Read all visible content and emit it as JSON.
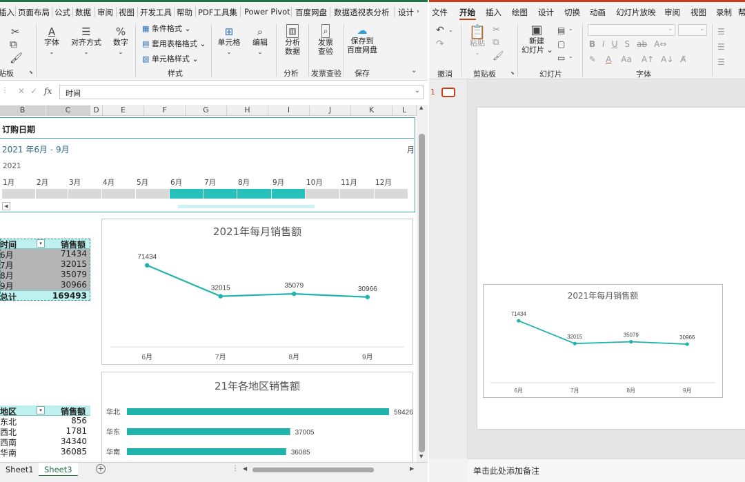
{
  "excel": {
    "tabs": [
      "插入",
      "页面布局",
      "公式",
      "数据",
      "审阅",
      "视图",
      "开发工具",
      "帮助",
      "PDF工具集",
      "Power Pivot",
      "百度网盘",
      "数据透视表分析",
      "设计"
    ],
    "ribbon": {
      "clipboard_group": "贴板",
      "font_label": "字体",
      "align_label": "对齐方式",
      "number_label": "数字",
      "cond_format": "条件格式",
      "table_format": "套用表格格式",
      "cell_style": "单元格样式",
      "style_group": "样式",
      "cells_label": "单元格",
      "edit_label": "编辑",
      "analyze_l1": "分析",
      "analyze_l2": "数据",
      "analyze_group": "分析",
      "invoice_l1": "发票",
      "invoice_l2": "查验",
      "invoice_group": "发票查验",
      "save_l1": "保存到",
      "save_l2": "百度网盘",
      "save_group": "保存"
    },
    "formula_bar": {
      "fx": "fx",
      "value": "时间"
    },
    "columns": [
      "B",
      "C",
      "D",
      "E",
      "F",
      "G",
      "H",
      "I",
      "J",
      "K",
      "L"
    ],
    "slicer": {
      "title": "订购日期",
      "range": "2021 年6月 - 9月",
      "unit": "月",
      "year": "2021",
      "months": [
        "1月",
        "2月",
        "3月",
        "4月",
        "5月",
        "6月",
        "7月",
        "8月",
        "9月",
        "10月",
        "11月",
        "12月"
      ],
      "selected": [
        5,
        6,
        7,
        8
      ]
    },
    "pivot_sales": {
      "header": [
        "时间",
        "销售额"
      ],
      "rows": [
        [
          "6月",
          "71434"
        ],
        [
          "7月",
          "32015"
        ],
        [
          "8月",
          "35079"
        ],
        [
          "9月",
          "30966"
        ]
      ],
      "total": [
        "总计",
        "169493"
      ]
    },
    "pivot_region": {
      "header": [
        "地区",
        "销售额"
      ],
      "rows": [
        [
          "东北",
          "856"
        ],
        [
          "西北",
          "1781"
        ],
        [
          "西南",
          "34340"
        ],
        [
          "华南",
          "36085"
        ]
      ]
    },
    "sheet_tabs": [
      "Sheet1",
      "Sheet3"
    ]
  },
  "ppt": {
    "tabs": [
      "文件",
      "开始",
      "插入",
      "绘图",
      "设计",
      "切换",
      "动画",
      "幻灯片放映",
      "审阅",
      "视图",
      "录制",
      "帮"
    ],
    "ribbon": {
      "undo_group": "撤消",
      "paste": "粘贴",
      "clipboard_group": "剪贴板",
      "new_slide_l1": "新建",
      "new_slide_l2": "幻灯片",
      "slides_group": "幻灯片",
      "font_group": "字体"
    },
    "slide_number": "1",
    "notes_placeholder": "单击此处添加备注"
  },
  "colors": {
    "teal": "#1FB3AC",
    "excel_green": "#217346",
    "ppt_orange": "#C43E1C"
  },
  "chart_data": [
    {
      "type": "line",
      "title": "2021年每月销售额",
      "categories": [
        "6月",
        "7月",
        "8月",
        "9月"
      ],
      "values": [
        71434,
        32015,
        35079,
        30966
      ],
      "data_labels": [
        "71434",
        "32015",
        "35079",
        "30966"
      ],
      "ylim": [
        0,
        80000
      ],
      "grid": false,
      "legend": "none"
    },
    {
      "type": "bar",
      "orientation": "horizontal",
      "title": "21年各地区销售额",
      "categories": [
        "华北",
        "华东",
        "华南"
      ],
      "values": [
        59426,
        37005,
        36085
      ],
      "data_labels": [
        "59426",
        "37005",
        "36085"
      ],
      "xlim": [
        0,
        70000
      ],
      "grid": false,
      "legend": "none"
    },
    {
      "type": "line",
      "title": "2021年每月销售额",
      "categories": [
        "6月",
        "7月",
        "8月",
        "9月"
      ],
      "values": [
        71434,
        32015,
        35079,
        30966
      ],
      "data_labels": [
        "71434",
        "32015",
        "35079",
        "30966"
      ],
      "ylim": [
        0,
        80000
      ],
      "grid": false,
      "legend": "none"
    }
  ]
}
